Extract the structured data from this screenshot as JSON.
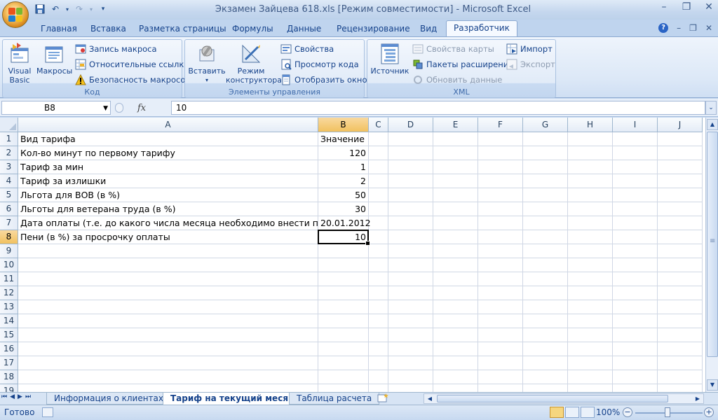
{
  "window": {
    "title": "Экзамен Зайцева 618.xls  [Режим совместимости] - Microsoft Excel"
  },
  "ribbon_tabs": [
    {
      "label": "Главная"
    },
    {
      "label": "Вставка"
    },
    {
      "label": "Разметка страницы"
    },
    {
      "label": "Формулы"
    },
    {
      "label": "Данные"
    },
    {
      "label": "Рецензирование"
    },
    {
      "label": "Вид"
    },
    {
      "label": "Разработчик",
      "active": true
    }
  ],
  "ribbon": {
    "code": {
      "label": "Код",
      "visual_basic": "Visual\nBasic",
      "macros": "Макросы",
      "record_macro": "Запись макроса",
      "relative_refs": "Относительные ссылки",
      "macro_security": "Безопасность макросов"
    },
    "controls": {
      "label": "Элементы управления",
      "insert": "Вставить",
      "design_mode": "Режим\nконструктора",
      "properties": "Свойства",
      "view_code": "Просмотр кода",
      "show_window": "Отобразить окно"
    },
    "xml": {
      "label": "XML",
      "source": "Источник",
      "map_properties": "Свойства карты",
      "expansion_packs": "Пакеты расширения",
      "refresh_data": "Обновить данные",
      "import": "Импорт",
      "export": "Экспорт"
    }
  },
  "formula_bar": {
    "name_box": "B8",
    "fx": "fx",
    "value": "10"
  },
  "columns": [
    "A",
    "B",
    "C",
    "D",
    "E",
    "F",
    "G",
    "H",
    "I",
    "J"
  ],
  "selected_column": "B",
  "selected_row": "8",
  "rows": [
    {
      "n": "1",
      "a": "Вид тарифа",
      "b": "Значение",
      "b_align": "left"
    },
    {
      "n": "2",
      "a": "Кол-во минут по первому тарифу",
      "b": "120"
    },
    {
      "n": "3",
      "a": "Тариф за мин",
      "b": "1"
    },
    {
      "n": "4",
      "a": "Тариф за излишки",
      "b": "2"
    },
    {
      "n": "5",
      "a": "Льгота для ВОВ (в %)",
      "b": "50"
    },
    {
      "n": "6",
      "a": "Льготы для ветерана труда (в %)",
      "b": "30"
    },
    {
      "n": "7",
      "a": "Дата оплаты (т.е. до какого числа месяца необходимо внести плат",
      "b": "20.01.2012"
    },
    {
      "n": "8",
      "a": "Пени (в %) за просрочку оплаты",
      "b": "10"
    },
    {
      "n": "9",
      "a": "",
      "b": ""
    },
    {
      "n": "10",
      "a": "",
      "b": ""
    },
    {
      "n": "11",
      "a": "",
      "b": ""
    },
    {
      "n": "12",
      "a": "",
      "b": ""
    },
    {
      "n": "13",
      "a": "",
      "b": ""
    },
    {
      "n": "14",
      "a": "",
      "b": ""
    },
    {
      "n": "15",
      "a": "",
      "b": ""
    },
    {
      "n": "16",
      "a": "",
      "b": ""
    },
    {
      "n": "17",
      "a": "",
      "b": ""
    },
    {
      "n": "18",
      "a": "",
      "b": ""
    },
    {
      "n": "19",
      "a": "",
      "b": ""
    }
  ],
  "sheets": [
    {
      "label": "Информация о клиентах"
    },
    {
      "label": "Тариф на текущий месяц",
      "active": true
    },
    {
      "label": "Таблица расчета"
    }
  ],
  "status": {
    "ready": "Готово",
    "zoom": "100%"
  }
}
